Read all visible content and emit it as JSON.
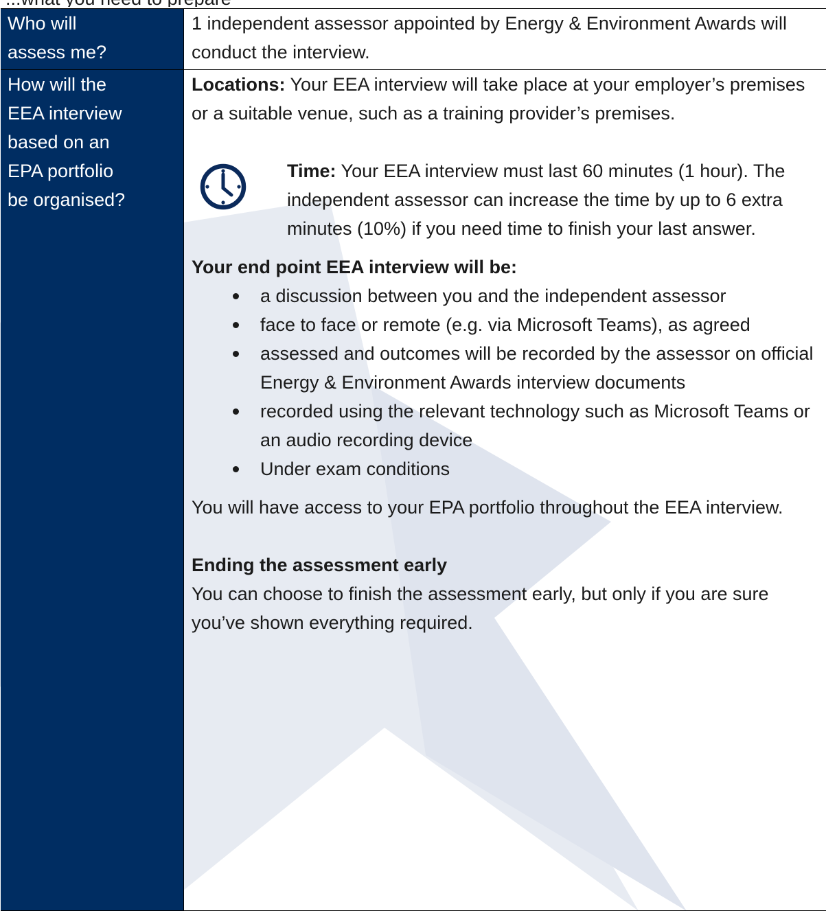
{
  "top_fragment": "...what you need to prepare",
  "rows": [
    {
      "question_lines": [
        "Who will",
        "assess me?"
      ],
      "answer": "1 independent assessor appointed by Energy & Environment Awards will conduct the interview."
    },
    {
      "question_lines": [
        "How will the",
        "EEA interview",
        "based on an",
        "EPA portfolio",
        "be organised?"
      ],
      "locations_label": "Locations:",
      "locations_text": " Your EEA interview will take place at your employer’s premises or a suitable venue, such as a training provider’s premises.",
      "time_label": "Time:",
      "time_text": " Your EEA interview must last 60 minutes (1 hour). The independent assessor can increase the time by up to 6 extra minutes (10%) if you need time to finish your last answer.",
      "interview_heading": "Your end point EEA interview will be:",
      "bullets": [
        "a discussion between you and the independent assessor",
        "face to face or remote (e.g. via Microsoft Teams), as agreed",
        "assessed and outcomes will be recorded by the assessor on official Energy & Environment Awards interview documents",
        "recorded using the relevant technology such as Microsoft Teams or an audio recording device",
        "Under exam conditions"
      ],
      "portfolio_text": "You will have access to your EPA portfolio throughout the EEA interview.",
      "ending_heading": "Ending the assessment early",
      "ending_text": "You can choose to finish the assessment early, but only if you are sure you’ve shown everything required."
    }
  ],
  "icons": {
    "clock": "clock-icon"
  },
  "colors": {
    "question_column": "#002d62",
    "watermark": "#e3e7f0",
    "icon": "#0b2a5b"
  }
}
